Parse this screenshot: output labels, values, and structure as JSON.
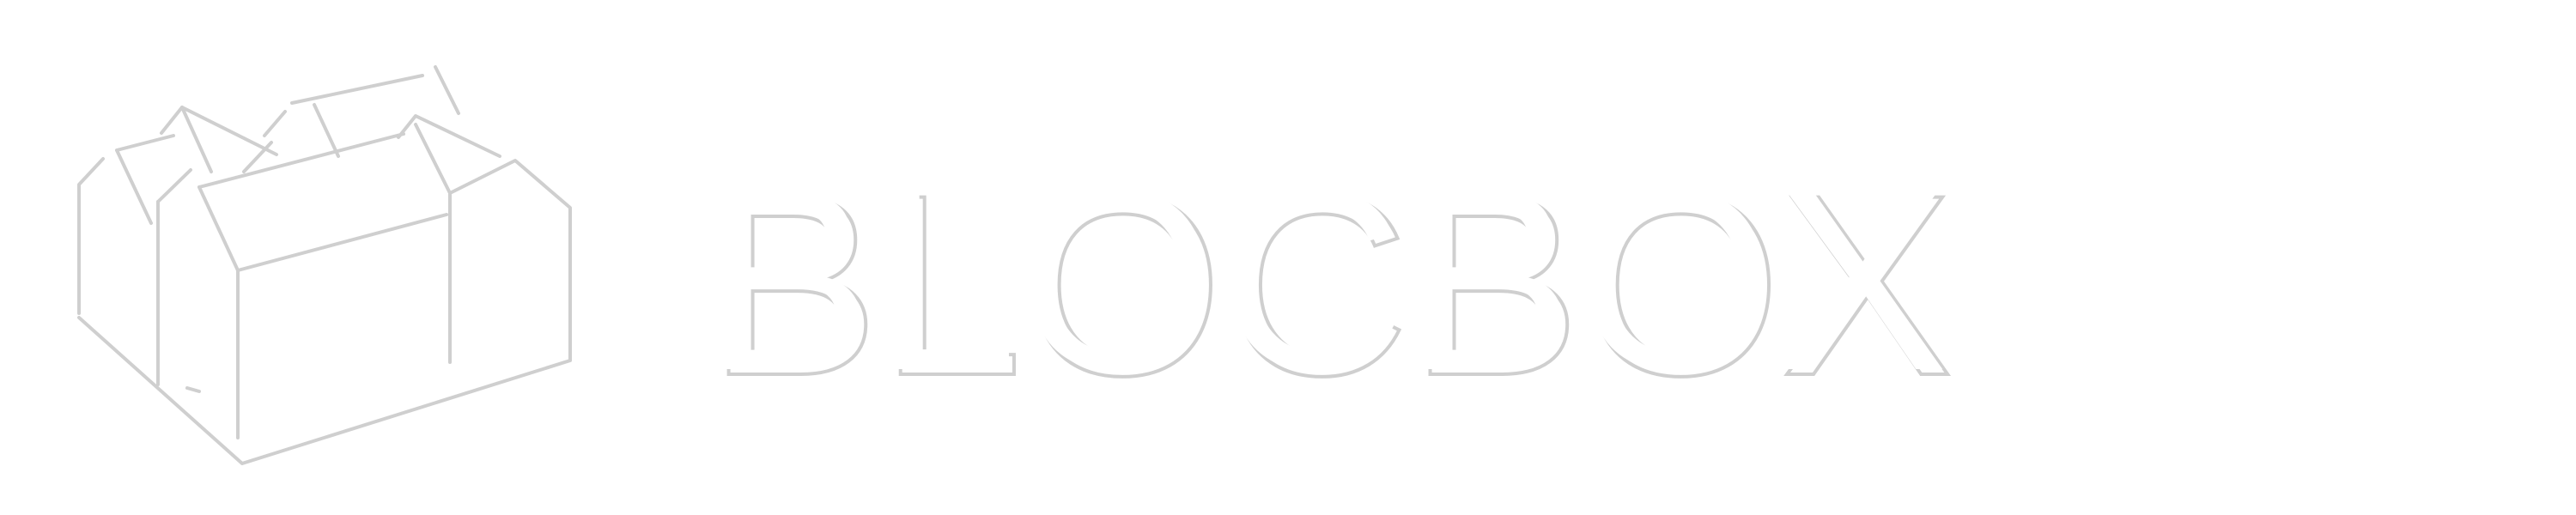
{
  "brand": {
    "name": "BLOCBOX"
  },
  "colors": {
    "background": "#ffffff",
    "fill": "#ffffff",
    "outline": "#cfcfcf"
  },
  "icons": {
    "mark": "blocbox-building-logo"
  }
}
